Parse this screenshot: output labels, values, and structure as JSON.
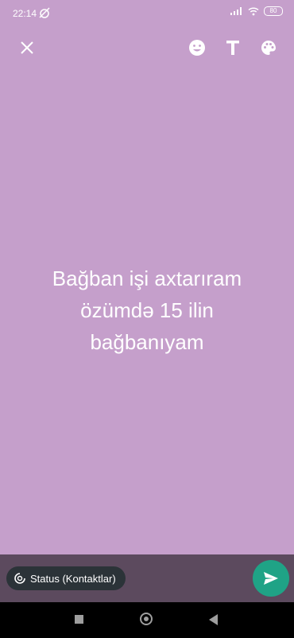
{
  "status_bar": {
    "time": "22:14",
    "battery": "80"
  },
  "toolbar": {
    "close_icon": "close-icon",
    "emoji_icon": "emoji-icon",
    "text_icon": "text-format-icon",
    "palette_icon": "palette-icon"
  },
  "status": {
    "text": "Bağban işi axtarıram özümdə 15 ilin bağbanıyam",
    "background_color": "#C59FCB"
  },
  "footer": {
    "privacy_label": "Status (Kontaktlar)",
    "send_icon": "send-icon",
    "send_color": "#1FA386"
  },
  "nav": {
    "recents": "recents-icon",
    "home": "home-icon",
    "back": "back-icon"
  }
}
